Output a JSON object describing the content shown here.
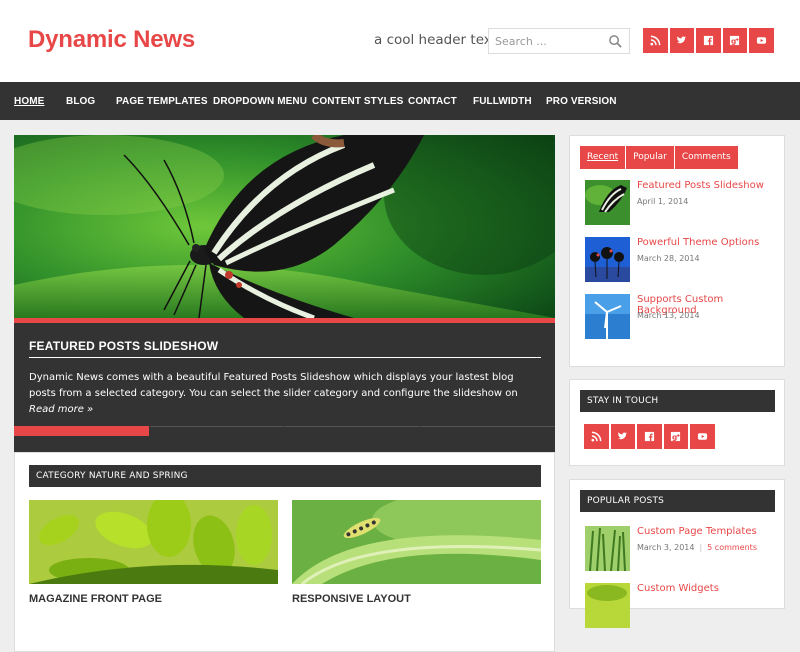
{
  "site": {
    "logo": "Dynamic News",
    "tagline": "a cool header text",
    "search_placeholder": "Search ...",
    "accent_color": "#e84747",
    "social_icons": [
      "rss-icon",
      "twitter-icon",
      "facebook-icon",
      "google-plus-icon",
      "youtube-icon"
    ]
  },
  "nav": {
    "items": [
      "HOME",
      "BLOG",
      "PAGE TEMPLATES",
      "DROPDOWN MENU",
      "CONTENT STYLES",
      "CONTACT",
      "FULLWIDTH",
      "PRO VERSION"
    ],
    "active": "HOME"
  },
  "slideshow": {
    "title": "FEATURED POSTS SLIDESHOW",
    "text": "Dynamic News comes with a beautiful Featured Posts Slideshow which displays your lastest blog posts from a selected category. You can select the slider category and configure the slideshow on",
    "more": "Read more »",
    "slides_total": 4,
    "active_slide": 1
  },
  "category": {
    "heading": "CATEGORY NATURE AND SPRING",
    "posts": [
      {
        "title": "MAGAZINE FRONT PAGE"
      },
      {
        "title": "RESPONSIVE LAYOUT"
      }
    ]
  },
  "sidebar": {
    "tabs": [
      "Recent",
      "Popular",
      "Comments"
    ],
    "active_tab": "Recent",
    "recent": [
      {
        "title": "Featured Posts Slideshow",
        "date": "April 1, 2014"
      },
      {
        "title": "Powerful Theme Options",
        "date": "March 28, 2014"
      },
      {
        "title": "Supports Custom Background",
        "date": "March 13, 2014"
      }
    ],
    "stay_in_touch": "STAY IN TOUCH",
    "popular_heading": "POPULAR POSTS",
    "popular": [
      {
        "title": "Custom Page Templates",
        "date": "March 3, 2014",
        "comments": "5 comments"
      },
      {
        "title": "Custom Widgets"
      }
    ]
  }
}
